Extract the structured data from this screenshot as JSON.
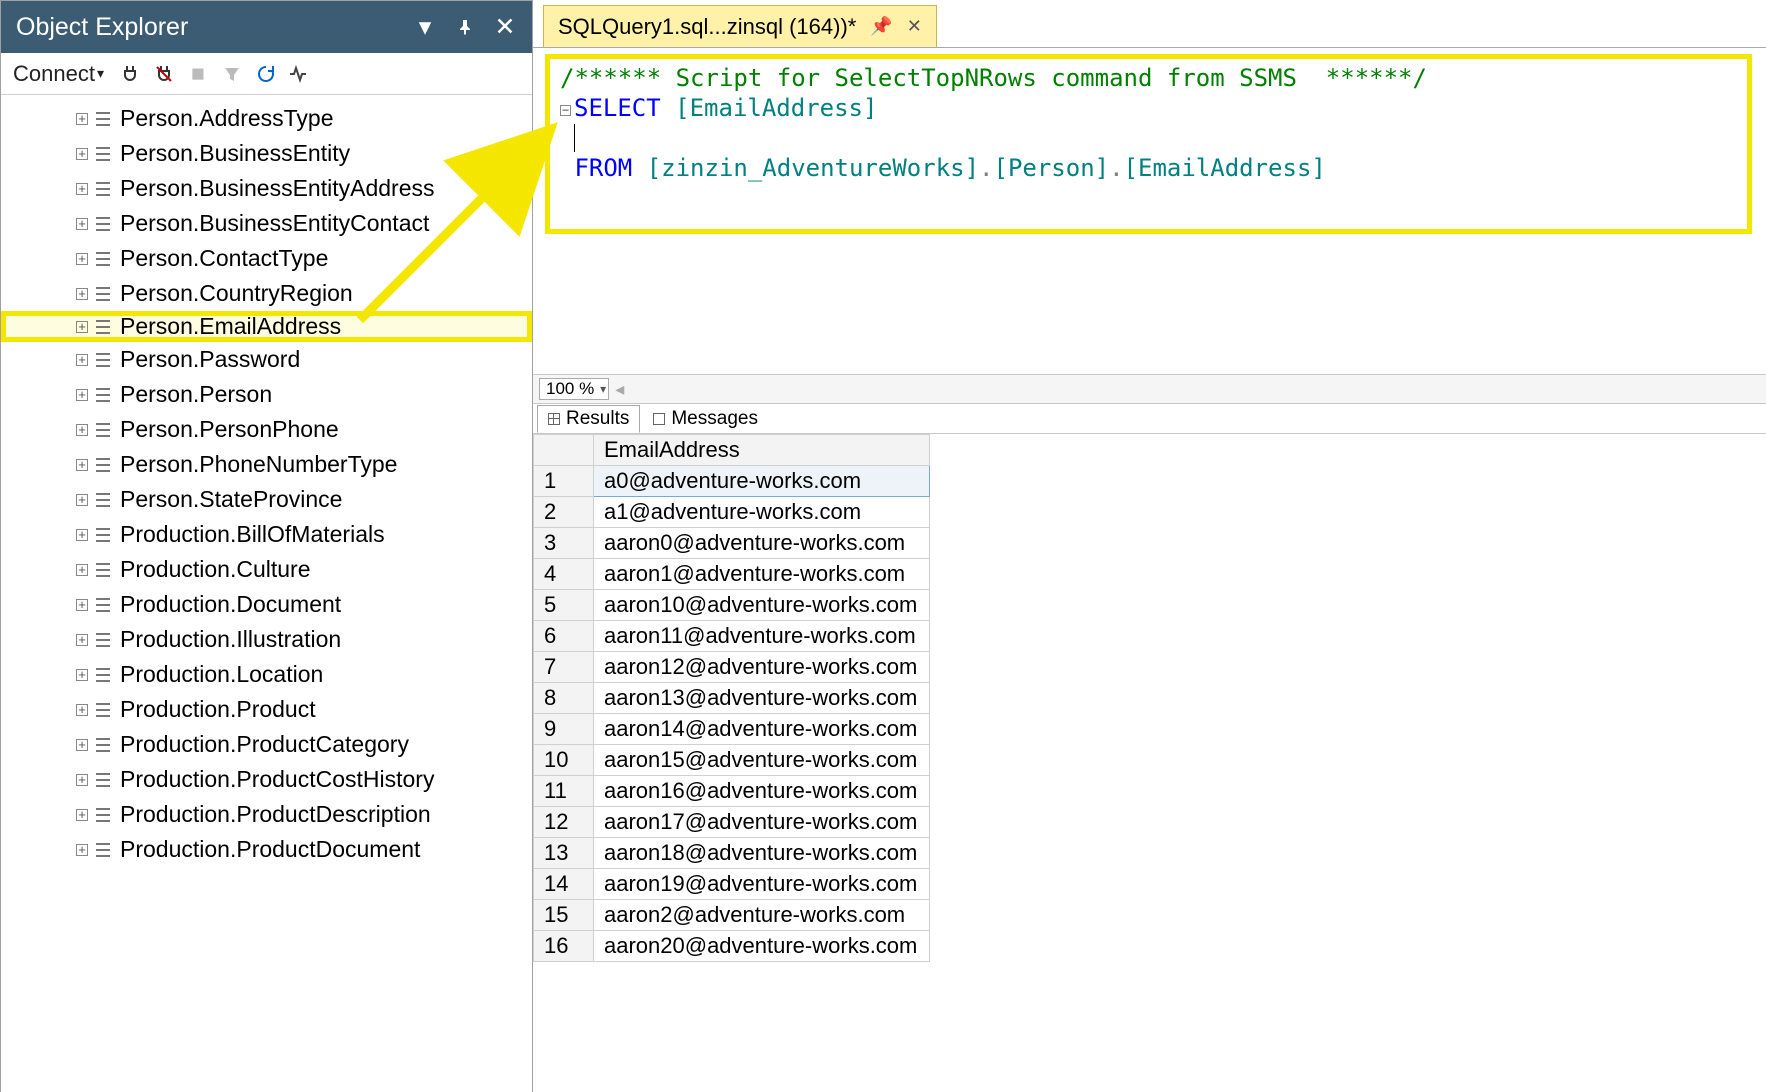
{
  "panel": {
    "title": "Object Explorer",
    "connect_label": "Connect"
  },
  "tree": {
    "items": [
      {
        "label": "Person.AddressType"
      },
      {
        "label": "Person.BusinessEntity"
      },
      {
        "label": "Person.BusinessEntityAddress"
      },
      {
        "label": "Person.BusinessEntityContact"
      },
      {
        "label": "Person.ContactType"
      },
      {
        "label": "Person.CountryRegion"
      },
      {
        "label": "Person.EmailAddress",
        "highlighted": true
      },
      {
        "label": "Person.Password"
      },
      {
        "label": "Person.Person"
      },
      {
        "label": "Person.PersonPhone"
      },
      {
        "label": "Person.PhoneNumberType"
      },
      {
        "label": "Person.StateProvince"
      },
      {
        "label": "Production.BillOfMaterials"
      },
      {
        "label": "Production.Culture"
      },
      {
        "label": "Production.Document"
      },
      {
        "label": "Production.Illustration"
      },
      {
        "label": "Production.Location"
      },
      {
        "label": "Production.Product"
      },
      {
        "label": "Production.ProductCategory"
      },
      {
        "label": "Production.ProductCostHistory"
      },
      {
        "label": "Production.ProductDescription"
      },
      {
        "label": "Production.ProductDocument"
      }
    ]
  },
  "tab": {
    "title": "SQLQuery1.sql...zinsql (164))*"
  },
  "editor": {
    "comment": "/****** Script for SelectTopNRows command from SSMS  ******/",
    "kw_select": "SELECT",
    "col": "[EmailAddress]",
    "kw_from": "FROM",
    "db": "[zinzin_AdventureWorks]",
    "schema": "[Person]",
    "table": "[EmailAddress]",
    "dot": "."
  },
  "zoom": {
    "value": "100 %"
  },
  "result_tabs": {
    "results": "Results",
    "messages": "Messages"
  },
  "grid": {
    "header": "EmailAddress",
    "rows": [
      "a0@adventure-works.com",
      "a1@adventure-works.com",
      "aaron0@adventure-works.com",
      "aaron1@adventure-works.com",
      "aaron10@adventure-works.com",
      "aaron11@adventure-works.com",
      "aaron12@adventure-works.com",
      "aaron13@adventure-works.com",
      "aaron14@adventure-works.com",
      "aaron15@adventure-works.com",
      "aaron16@adventure-works.com",
      "aaron17@adventure-works.com",
      "aaron18@adventure-works.com",
      "aaron19@adventure-works.com",
      "aaron2@adventure-works.com",
      "aaron20@adventure-works.com"
    ]
  }
}
